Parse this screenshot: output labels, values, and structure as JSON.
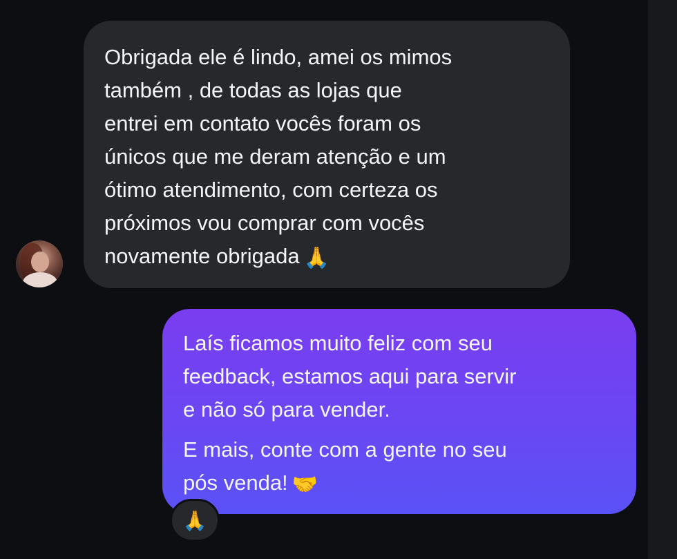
{
  "incoming_message": {
    "lines": [
      "Obrigada ele é lindo, amei os mimos",
      "também , de todas as lojas que",
      "entrei em contato vocês foram os",
      "únicos que me deram atenção e um",
      "ótimo atendimento, com certeza os",
      "próximos vou comprar com vocês",
      "novamente obrigada"
    ],
    "trailing_emoji": "🙏"
  },
  "outgoing_message": {
    "paragraph1_lines": [
      "Laís ficamos muito feliz com seu",
      "feedback, estamos aqui para servir",
      "e não só para vender."
    ],
    "paragraph2_lines": [
      "E mais, conte com a gente no seu",
      "pós venda!"
    ],
    "trailing_emoji": "🤝"
  },
  "reaction": {
    "emoji": "🙏"
  },
  "colors": {
    "background": "#0c0e12",
    "incoming_bubble": "#26282c",
    "outgoing_gradient_top": "#7a3df0",
    "outgoing_gradient_bottom": "#5a52f6",
    "text": "#f4f5f7"
  }
}
